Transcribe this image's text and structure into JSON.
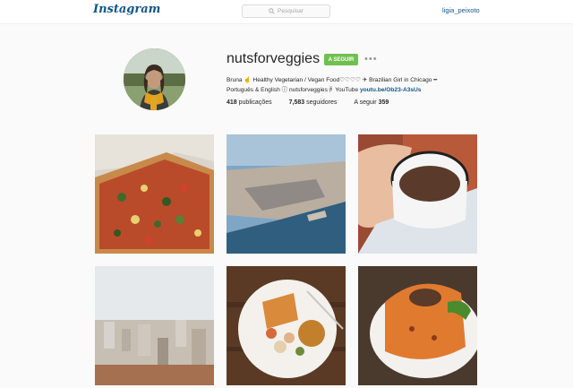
{
  "header": {
    "logo": "Instagram",
    "search_placeholder": "Pesquisar",
    "current_user": "ligia_peixoto"
  },
  "profile": {
    "username": "nutsforveggies",
    "follow_label": "A SEGUIR",
    "more_label": "•••",
    "bio_line1": "Bruna ☝ Healthy Vegetarian / Vegan Food♡♡♡♡ ✈ Brazilian Girl in Chicago ━",
    "bio_line2_prefix": "Português & English ⓘ nutsforveggies☟ YouTube ",
    "bio_link": "youtu.be/Ob23-A3sUs",
    "stats": {
      "posts_count": "418",
      "posts_label": "publicações",
      "followers_count": "7,583",
      "followers_label": "seguidores",
      "following_label": "A seguir",
      "following_count": "359"
    }
  },
  "posts": [
    {
      "subject": "pizza"
    },
    {
      "subject": "city-aerial"
    },
    {
      "subject": "coffee-mug"
    },
    {
      "subject": "city-skyline"
    },
    {
      "subject": "plate-of-food"
    },
    {
      "subject": "bundt-cake"
    }
  ],
  "colors": {
    "link": "#125688",
    "follow_button": "#70c050",
    "background": "#fafafa"
  }
}
